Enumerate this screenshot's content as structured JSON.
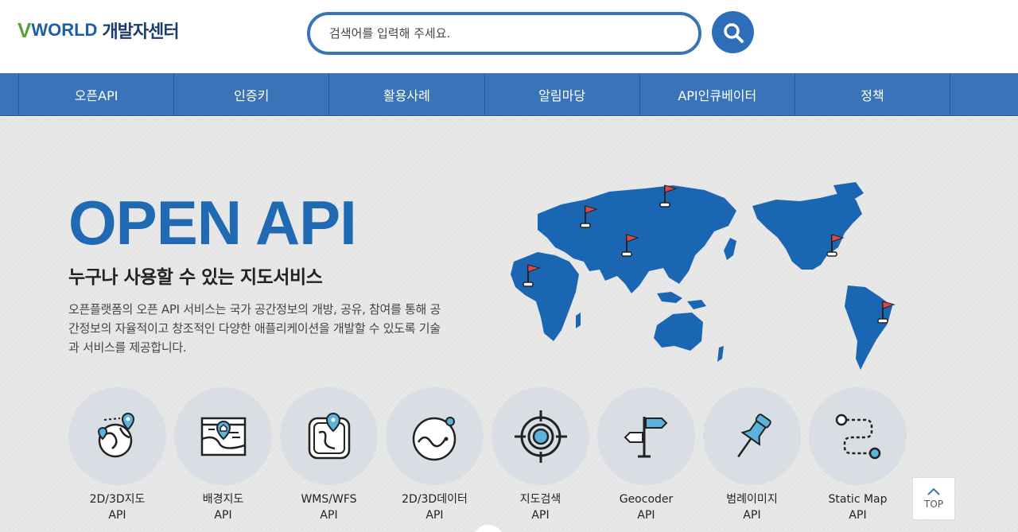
{
  "header": {
    "logo_mark": "WORLD",
    "logo_v": "V",
    "logo_text": "개발자센터",
    "search_placeholder": "검색어를 입력해 주세요.",
    "search_icon": "search-icon"
  },
  "nav": {
    "items": [
      {
        "label": "오픈API"
      },
      {
        "label": "인증키"
      },
      {
        "label": "활용사례"
      },
      {
        "label": "알림마당"
      },
      {
        "label": "API인큐베이터"
      },
      {
        "label": "정책"
      }
    ]
  },
  "hero": {
    "title": "OPEN API",
    "subtitle": "누구나 사용할 수 있는 지도서비스",
    "description": "오픈플랫폼의 오픈 API 서비스는 국가 공간정보의 개방, 공유, 참여를 통해 공간정보의 자율적이고 창조적인 다양한 애플리케이션을 개발할 수 있도록 기술과 서비스를 제공합니다."
  },
  "apis": [
    {
      "line1": "2D/3D지도",
      "line2": "API",
      "icon": "globe-pin-icon"
    },
    {
      "line1": "배경지도",
      "line2": "API",
      "icon": "map-window-icon"
    },
    {
      "line1": "WMS/WFS",
      "line2": "API",
      "icon": "map-pin-icon"
    },
    {
      "line1": "2D/3D데이터",
      "line2": "API",
      "icon": "data-globe-icon"
    },
    {
      "line1": "지도검색",
      "line2": "API",
      "icon": "target-icon"
    },
    {
      "line1": "Geocoder",
      "line2": "API",
      "icon": "signpost-icon"
    },
    {
      "line1": "범례이미지",
      "line2": "API",
      "icon": "pushpin-icon"
    },
    {
      "line1": "Static Map",
      "line2": "API",
      "icon": "route-icon"
    }
  ],
  "top_button": {
    "label": "TOP"
  },
  "colors": {
    "accent": "#3a74b8",
    "title_blue": "#1f6ab3",
    "icon_blue": "#5bb2de",
    "flag_red": "#e04848"
  }
}
